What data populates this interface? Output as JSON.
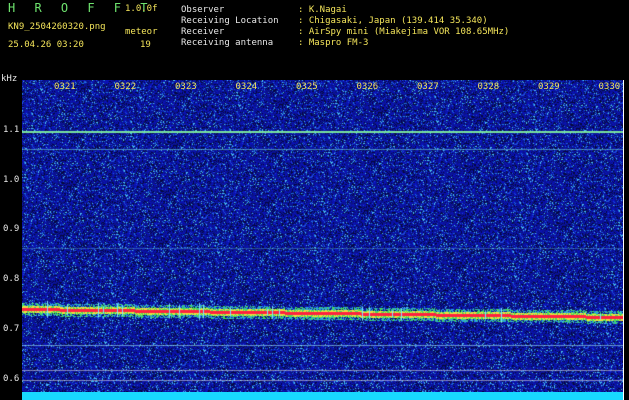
{
  "header": {
    "logo": "H R O F F T",
    "version": "1.0.0f",
    "filename": "KN9_2504260320.png",
    "meteor_label": "meteor",
    "meteor_count": "19",
    "datetime": "25.04.26 03:20",
    "observer_label": "Observer",
    "observer_value": ": K.Nagai",
    "location_label": "Receiving Location",
    "location_value": ": Chigasaki, Japan (139.414 35.340)",
    "receiver_label": "Receiver",
    "receiver_value": ": AirSpy mini (Miakejima VOR 108.65MHz)",
    "antenna_label": "Receiving antenna",
    "antenna_value": ": Maspro FM-3"
  },
  "y_axis": {
    "unit": "kHz",
    "ticks": [
      "1.1",
      "1.0",
      "0.9",
      "0.8",
      "0.7",
      "0.6"
    ]
  },
  "time_ticks": [
    "0321",
    "0322",
    "0323",
    "0324",
    "0325",
    "0326",
    "0327",
    "0328",
    "0329",
    "0330"
  ],
  "colors": {
    "background_noise": "#1a1fa8",
    "signal_red": "#ff2040",
    "signal_green": "#46e05a",
    "bottom_bar": "#18d9ff"
  }
}
